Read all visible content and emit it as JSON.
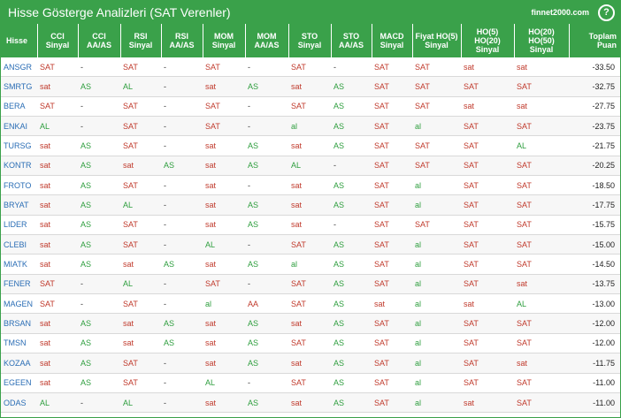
{
  "header": {
    "title": "Hisse Gösterge Analizleri (SAT Verenler)",
    "brand": "finnet2000.com",
    "help": "?"
  },
  "columns": [
    "Hisse",
    "CCI Sinyal",
    "CCI AA/AS",
    "RSI Sinyal",
    "RSI AA/AS",
    "MOM Sinyal",
    "MOM AA/AS",
    "STO Sinyal",
    "STO AA/AS",
    "MACD Sinyal",
    "Fiyat HO(5) Sinyal",
    "HO(5) HO(20) Sinyal",
    "HO(20) HO(50) Sinyal",
    "Toplam Puan"
  ],
  "rows": [
    [
      "ANSGR",
      "SAT",
      "-",
      "SAT",
      "-",
      "SAT",
      "-",
      "SAT",
      "-",
      "SAT",
      "SAT",
      "sat",
      "sat",
      "-33.50"
    ],
    [
      "SMRTG",
      "sat",
      "AS",
      "AL",
      "-",
      "sat",
      "AS",
      "sat",
      "AS",
      "SAT",
      "SAT",
      "SAT",
      "SAT",
      "-32.75"
    ],
    [
      "BERA",
      "SAT",
      "-",
      "SAT",
      "-",
      "SAT",
      "-",
      "SAT",
      "AS",
      "SAT",
      "SAT",
      "sat",
      "sat",
      "-27.75"
    ],
    [
      "ENKAI",
      "AL",
      "-",
      "SAT",
      "-",
      "SAT",
      "-",
      "al",
      "AS",
      "SAT",
      "al",
      "SAT",
      "SAT",
      "-23.75"
    ],
    [
      "TURSG",
      "sat",
      "AS",
      "SAT",
      "-",
      "sat",
      "AS",
      "sat",
      "AS",
      "SAT",
      "SAT",
      "SAT",
      "AL",
      "-21.75"
    ],
    [
      "KONTR",
      "sat",
      "AS",
      "sat",
      "AS",
      "sat",
      "AS",
      "AL",
      "-",
      "SAT",
      "SAT",
      "SAT",
      "SAT",
      "-20.25"
    ],
    [
      "FROTO",
      "sat",
      "AS",
      "SAT",
      "-",
      "sat",
      "-",
      "sat",
      "AS",
      "SAT",
      "al",
      "SAT",
      "SAT",
      "-18.50"
    ],
    [
      "BRYAT",
      "sat",
      "AS",
      "AL",
      "-",
      "sat",
      "AS",
      "sat",
      "AS",
      "SAT",
      "al",
      "SAT",
      "SAT",
      "-17.75"
    ],
    [
      "LIDER",
      "sat",
      "AS",
      "SAT",
      "-",
      "sat",
      "AS",
      "sat",
      "-",
      "SAT",
      "SAT",
      "SAT",
      "SAT",
      "-15.75"
    ],
    [
      "CLEBI",
      "sat",
      "AS",
      "SAT",
      "-",
      "AL",
      "-",
      "SAT",
      "AS",
      "SAT",
      "al",
      "SAT",
      "SAT",
      "-15.00"
    ],
    [
      "MIATK",
      "sat",
      "AS",
      "sat",
      "AS",
      "sat",
      "AS",
      "al",
      "AS",
      "SAT",
      "al",
      "SAT",
      "SAT",
      "-14.50"
    ],
    [
      "FENER",
      "SAT",
      "-",
      "AL",
      "-",
      "SAT",
      "-",
      "SAT",
      "AS",
      "SAT",
      "al",
      "SAT",
      "sat",
      "-13.75"
    ],
    [
      "MAGEN",
      "SAT",
      "-",
      "SAT",
      "-",
      "al",
      "AA",
      "SAT",
      "AS",
      "sat",
      "al",
      "sat",
      "AL",
      "-13.00"
    ],
    [
      "BRSAN",
      "sat",
      "AS",
      "sat",
      "AS",
      "sat",
      "AS",
      "sat",
      "AS",
      "SAT",
      "al",
      "SAT",
      "SAT",
      "-12.00"
    ],
    [
      "TMSN",
      "sat",
      "AS",
      "sat",
      "AS",
      "sat",
      "AS",
      "SAT",
      "AS",
      "SAT",
      "al",
      "SAT",
      "SAT",
      "-12.00"
    ],
    [
      "KOZAA",
      "sat",
      "AS",
      "SAT",
      "-",
      "sat",
      "AS",
      "sat",
      "AS",
      "SAT",
      "al",
      "SAT",
      "sat",
      "-11.75"
    ],
    [
      "EGEEN",
      "sat",
      "AS",
      "SAT",
      "-",
      "AL",
      "-",
      "SAT",
      "AS",
      "SAT",
      "al",
      "SAT",
      "SAT",
      "-11.00"
    ],
    [
      "ODAS",
      "AL",
      "-",
      "AL",
      "-",
      "sat",
      "AS",
      "sat",
      "AS",
      "SAT",
      "al",
      "sat",
      "SAT",
      "-11.00"
    ]
  ]
}
